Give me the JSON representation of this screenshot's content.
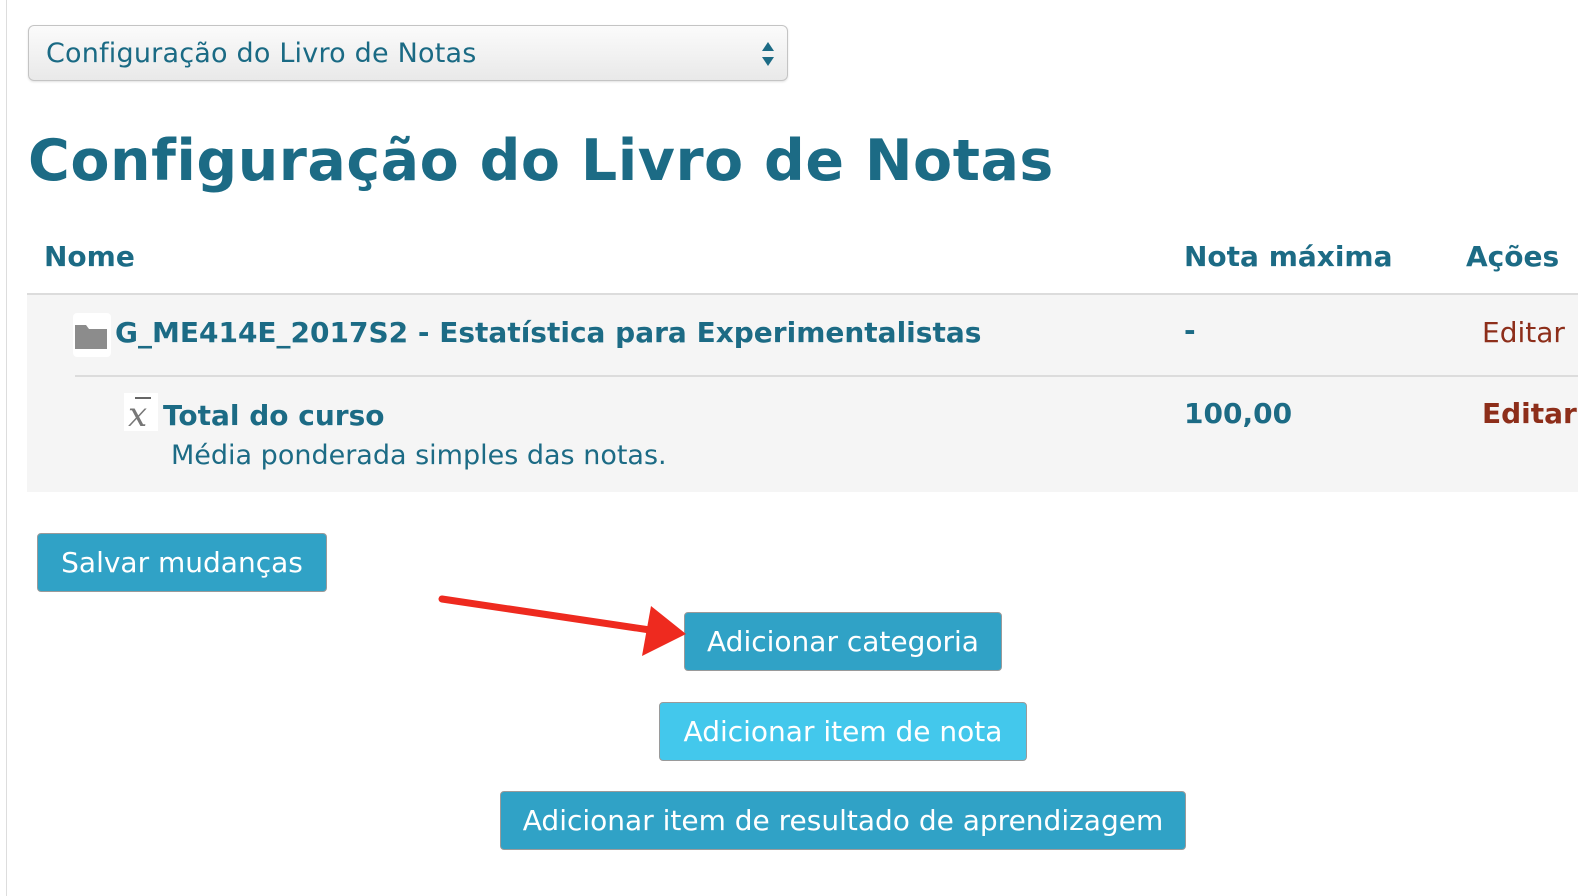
{
  "select": {
    "value": "Configuração do Livro de Notas",
    "icon": "up-down-arrows-icon"
  },
  "page_title": "Configuração do Livro de Notas",
  "table": {
    "headers": {
      "name": "Nome",
      "max_grade": "Nota máxima",
      "actions": "Ações"
    },
    "category_row": {
      "icon": "folder-icon",
      "name": "G_ME414E_2017S2 - Estatística para Experimentalistas",
      "max_grade": "-",
      "action": "Editar"
    },
    "total_row": {
      "icon": "mean-xbar-icon",
      "name": "Total do curso",
      "description": "Média ponderada simples das notas.",
      "max_grade": "100,00",
      "action": "Editar"
    }
  },
  "buttons": {
    "save": "Salvar mudanças",
    "add_category": "Adicionar categoria",
    "add_grade_item": "Adicionar item de nota",
    "add_outcome_item": "Adicionar item de resultado de aprendizagem"
  },
  "colors": {
    "heading": "#1c6b85",
    "action_link": "#8d2e1a",
    "button": "#30a2c6",
    "button_highlight": "#43c8ec",
    "annotation_arrow": "#ee2a1f"
  }
}
